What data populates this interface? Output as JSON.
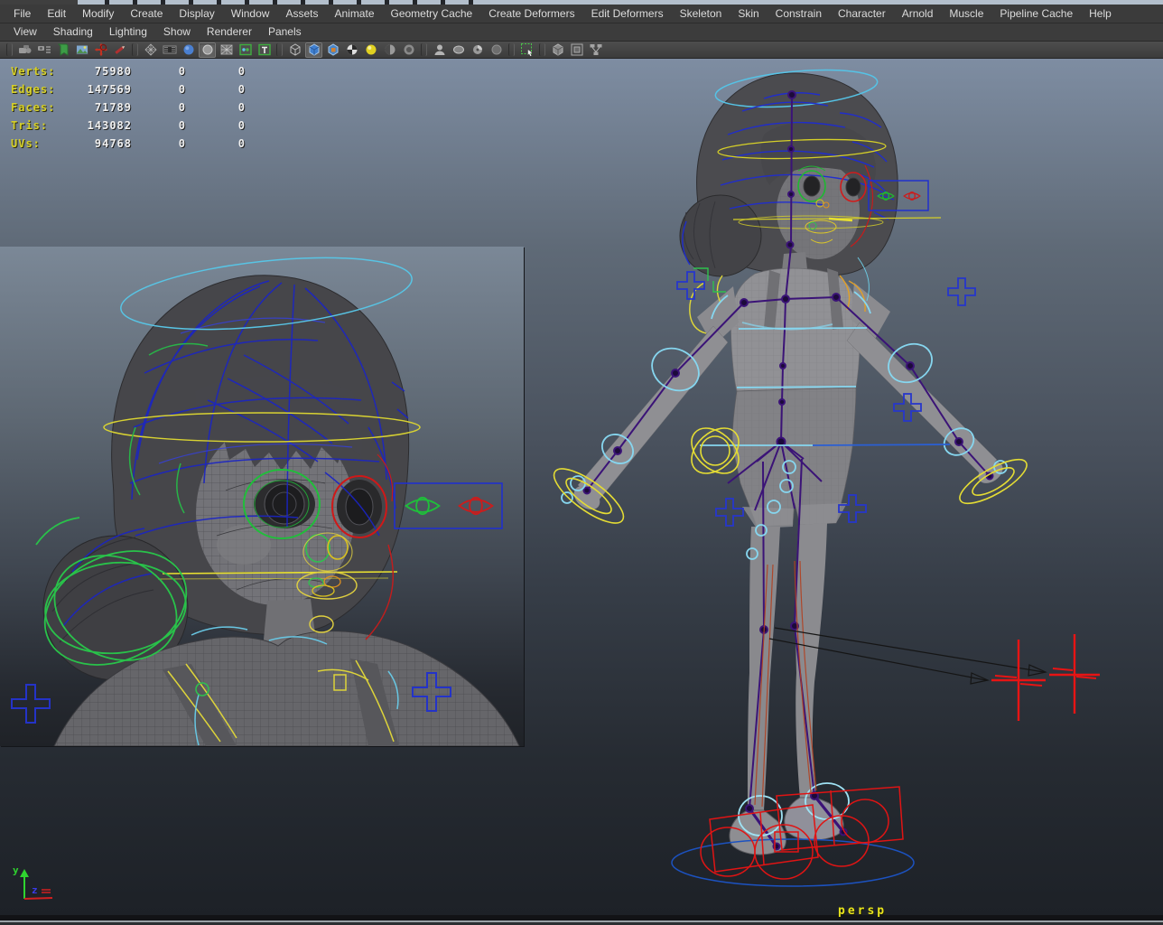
{
  "menubar": {
    "items": [
      "File",
      "Edit",
      "Modify",
      "Create",
      "Display",
      "Window",
      "Assets",
      "Animate",
      "Geometry Cache",
      "Create Deformers",
      "Edit Deformers",
      "Skeleton",
      "Skin",
      "Constrain",
      "Character",
      "Arnold",
      "Muscle",
      "Pipeline Cache",
      "Help"
    ]
  },
  "panel_menubar": {
    "items": [
      "View",
      "Shading",
      "Lighting",
      "Show",
      "Renderer",
      "Panels"
    ]
  },
  "toolbar": {
    "icons": [
      "select-camera",
      "camera-attributes",
      "bookmarks",
      "image-plane",
      "pan-zoom",
      "grease-pencil",
      "grid",
      "film-gate",
      "resolution-gate",
      "gate-mask",
      "field-chart",
      "safe-action",
      "safe-title",
      "wireframe",
      "smooth-shade",
      "textured",
      "use-default-material",
      "lights",
      "shadows",
      "ambient-occlusion",
      "isolate-select",
      "xray",
      "xray-joints",
      "plugin-shading",
      "object-selection",
      "scene-assembly",
      "frame-selection",
      "hypergraph"
    ]
  },
  "hud": {
    "rows": [
      {
        "label": "Verts:",
        "value": "75980",
        "col2": "0",
        "col3": "0"
      },
      {
        "label": "Edges:",
        "value": "147569",
        "col2": "0",
        "col3": "0"
      },
      {
        "label": "Faces:",
        "value": "71789",
        "col2": "0",
        "col3": "0"
      },
      {
        "label": "Tris:",
        "value": "143082",
        "col2": "0",
        "col3": "0"
      },
      {
        "label": "UVs:",
        "value": "94768",
        "col2": "0",
        "col3": "0"
      }
    ]
  },
  "viewport": {
    "camera_label": "persp",
    "axis_labels": {
      "y": "y",
      "z": "z"
    }
  },
  "colors": {
    "hud_label": "#d6d02a",
    "hud_value": "#f0f0f0",
    "camera_label": "#e8e41c",
    "selection_blue": "#2636cc",
    "rig_cyan": "#86d6ef",
    "rig_yellow": "#e4dc34",
    "rig_green": "#2ec24e",
    "rig_red": "#e01414",
    "skeleton_purple": "#3b1377",
    "hair_wire_blue": "#1a24c6",
    "viewport_top": "#7e8da2",
    "viewport_bottom": "#1d2127"
  }
}
